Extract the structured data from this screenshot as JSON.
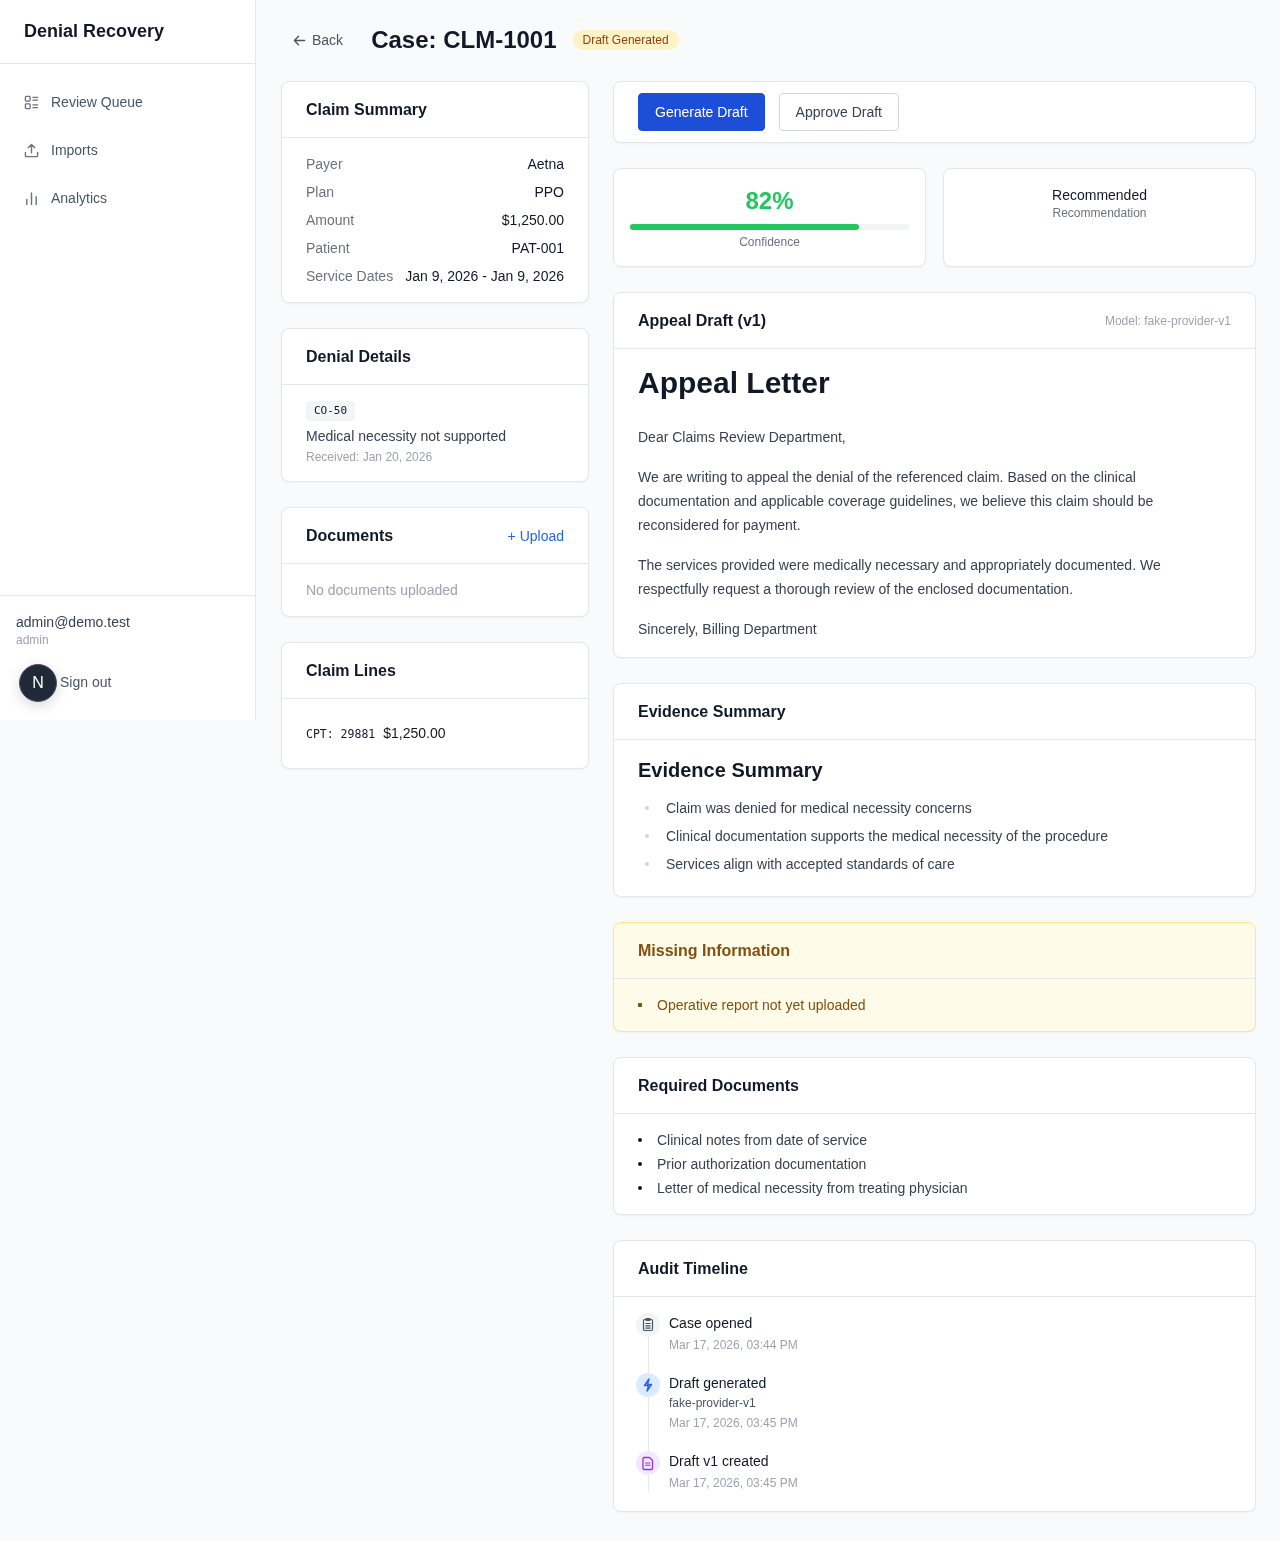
{
  "sidebar": {
    "title": "Denial Recovery",
    "nav": [
      {
        "label": "Review Queue",
        "kind": "queue"
      },
      {
        "label": "Imports",
        "kind": "upload"
      },
      {
        "label": "Analytics",
        "kind": "chart"
      }
    ],
    "user": {
      "email": "admin@demo.test",
      "role": "admin"
    },
    "sign_out": "Sign out"
  },
  "dev_tools": {
    "label": "N"
  },
  "header": {
    "back": "Back",
    "title": "Case: CLM-1001",
    "status": "Draft Generated"
  },
  "claim_summary": {
    "title": "Claim Summary",
    "rows": [
      {
        "label": "Payer",
        "value": "Aetna"
      },
      {
        "label": "Plan",
        "value": "PPO"
      },
      {
        "label": "Amount",
        "value": "$1,250.00"
      },
      {
        "label": "Patient",
        "value": "PAT-001"
      },
      {
        "label": "Service Dates",
        "value": "Jan 9, 2026 - Jan 9, 2026"
      }
    ]
  },
  "denial_details": {
    "title": "Denial Details",
    "code": "CO-50",
    "reason": "Medical necessity not supported",
    "received": "Received: Jan 20, 2026"
  },
  "documents": {
    "title": "Documents",
    "upload": "+ Upload",
    "empty": "No documents uploaded"
  },
  "claim_lines": {
    "title": "Claim Lines",
    "lines": [
      {
        "code": "CPT: 29881",
        "amount": "$1,250.00"
      }
    ]
  },
  "actions": [
    {
      "label": "Generate Draft",
      "kind": "primary"
    },
    {
      "label": "Approve Draft",
      "kind": "secondary"
    }
  ],
  "confidence": {
    "value": "82%",
    "level": 0.82,
    "label": "Confidence"
  },
  "recommendation": {
    "value": "Recommended",
    "label": "Recommendation"
  },
  "appeal_draft": {
    "title": "Appeal Draft (v1)",
    "model": "Model: fake-provider-v1",
    "heading": "Appeal Letter",
    "paragraphs": [
      "Dear Claims Review Department,",
      "We are writing to appeal the denial of the referenced claim. Based on the clinical documentation and applicable coverage guidelines, we believe this claim should be reconsidered for payment.",
      "The services provided were medically necessary and appropriately documented. We respectfully request a thorough review of the enclosed documentation.",
      "Sincerely, Billing Department"
    ]
  },
  "evidence_summary": {
    "title": "Evidence Summary",
    "heading": "Evidence Summary",
    "items": [
      "Claim was denied for medical necessity concerns",
      "Clinical documentation supports the medical necessity of the procedure",
      "Services align with accepted standards of care"
    ]
  },
  "missing_information": {
    "title": "Missing Information",
    "items": [
      "Operative report not yet uploaded"
    ]
  },
  "required_documents": {
    "title": "Required Documents",
    "items": [
      "Clinical notes from date of service",
      "Prior authorization documentation",
      "Letter of medical necessity from treating physician"
    ]
  },
  "audit_timeline": {
    "title": "Audit Timeline",
    "events": [
      {
        "kind": "opened",
        "title": "Case opened",
        "time": "Mar 17, 2026, 03:44 PM"
      },
      {
        "kind": "generated",
        "title": "Draft generated",
        "detail": "fake-provider-v1",
        "time": "Mar 17, 2026, 03:45 PM"
      },
      {
        "kind": "created",
        "title": "Draft v1 created",
        "time": "Mar 17, 2026, 03:45 PM"
      }
    ]
  }
}
